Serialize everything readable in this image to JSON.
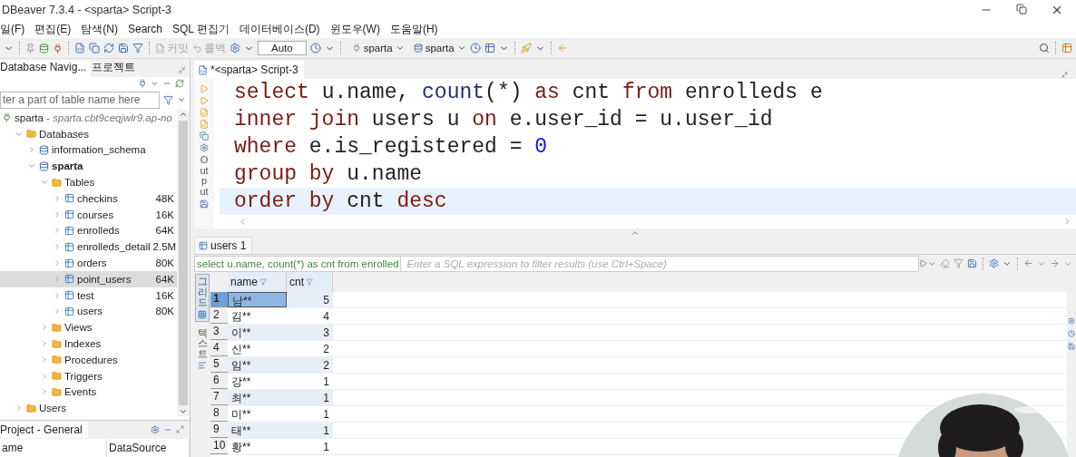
{
  "window": {
    "title": "DBeaver 7.3.4 - <sparta> Script-3"
  },
  "menu": [
    "일(F)",
    "편집(E)",
    "탐색(N)",
    "Search",
    "SQL 편집기",
    "데이터베이스(D)",
    "윈도우(W)",
    "도움말(H)"
  ],
  "toolbar": {
    "commit": {
      "label": "커밋",
      "disabled": true
    },
    "rollback": {
      "label": "롤백",
      "disabled": true
    },
    "mode": "Auto",
    "connection": "sparta",
    "schema": "sparta"
  },
  "navigator": {
    "tabs": [
      {
        "label": "Database Navig...",
        "selected": true
      },
      {
        "label": "프로젝트",
        "selected": false
      }
    ],
    "filter": {
      "placeholder": "ter a part of table name here"
    },
    "tree": [
      {
        "label": "sparta",
        "kind": "connection",
        "detail": "- sparta.cbt9ceqjwlr9.ap-no",
        "selected": false,
        "children": [
          {
            "label": "Databases",
            "kind": "folder",
            "expanded": true,
            "selected": false,
            "children": [
              {
                "label": "information_schema",
                "kind": "database",
                "active": false,
                "expanded": false,
                "selected": false
              },
              {
                "label": "sparta",
                "kind": "database",
                "active": true,
                "expanded": true,
                "selected": false,
                "children": [
                  {
                    "label": "Tables",
                    "kind": "folder",
                    "expanded": true,
                    "selected": false,
                    "children": [
                      {
                        "label": "checkins",
                        "kind": "table",
                        "size": "48K",
                        "expanded": false,
                        "selected": false
                      },
                      {
                        "label": "courses",
                        "kind": "table",
                        "size": "16K",
                        "expanded": false,
                        "selected": false
                      },
                      {
                        "label": "enrolleds",
                        "kind": "table",
                        "size": "64K",
                        "expanded": false,
                        "selected": false
                      },
                      {
                        "label": "enrolleds_detail",
                        "kind": "table",
                        "size": "2.5M",
                        "expanded": false,
                        "selected": false
                      },
                      {
                        "label": "orders",
                        "kind": "table",
                        "size": "80K",
                        "expanded": false,
                        "selected": false
                      },
                      {
                        "label": "point_users",
                        "kind": "table",
                        "size": "64K",
                        "expanded": false,
                        "selected": true
                      },
                      {
                        "label": "test",
                        "kind": "table",
                        "size": "16K",
                        "expanded": false,
                        "selected": false
                      },
                      {
                        "label": "users",
                        "kind": "table",
                        "size": "80K",
                        "expanded": false,
                        "selected": false
                      }
                    ]
                  },
                  {
                    "label": "Views",
                    "kind": "folder",
                    "expanded": false,
                    "selected": false
                  },
                  {
                    "label": "Indexes",
                    "kind": "folder",
                    "expanded": false,
                    "selected": false
                  },
                  {
                    "label": "Procedures",
                    "kind": "folder",
                    "expanded": false,
                    "selected": false
                  },
                  {
                    "label": "Triggers",
                    "kind": "folder",
                    "expanded": false,
                    "selected": false
                  },
                  {
                    "label": "Events",
                    "kind": "folder",
                    "expanded": false,
                    "selected": false
                  }
                ]
              }
            ]
          },
          {
            "label": "Users",
            "kind": "folder",
            "expanded": false,
            "selected": false
          }
        ]
      }
    ]
  },
  "project": {
    "title": "Project - General",
    "columns": [
      "ame",
      "DataSource"
    ]
  },
  "editor": {
    "tab": "*<sparta> Script-3",
    "side_label": "Output",
    "lines": [
      {
        "current": false,
        "tokens": [
          {
            "kind": "keyword",
            "text": "select"
          },
          {
            "kind": "plain",
            "text": " u.name, "
          },
          {
            "kind": "function",
            "text": "count"
          },
          {
            "kind": "plain",
            "text": "(*) "
          },
          {
            "kind": "keyword",
            "text": "as"
          },
          {
            "kind": "plain",
            "text": " cnt "
          },
          {
            "kind": "keyword",
            "text": "from"
          },
          {
            "kind": "plain",
            "text": " enrolleds e"
          }
        ]
      },
      {
        "current": false,
        "tokens": [
          {
            "kind": "keyword",
            "text": "inner join"
          },
          {
            "kind": "plain",
            "text": " users u "
          },
          {
            "kind": "keyword",
            "text": "on"
          },
          {
            "kind": "plain",
            "text": " e.user_id = u.user_id"
          }
        ]
      },
      {
        "current": false,
        "tokens": [
          {
            "kind": "keyword",
            "text": "where"
          },
          {
            "kind": "plain",
            "text": " e.is_registered = "
          },
          {
            "kind": "number",
            "text": "0"
          }
        ]
      },
      {
        "current": false,
        "tokens": [
          {
            "kind": "keyword",
            "text": "group by"
          },
          {
            "kind": "plain",
            "text": " u.name"
          }
        ]
      },
      {
        "current": true,
        "tokens": [
          {
            "kind": "keyword",
            "text": "order by"
          },
          {
            "kind": "plain",
            "text": " cnt "
          },
          {
            "kind": "keyword",
            "text": "desc"
          }
        ]
      }
    ]
  },
  "results": {
    "tab": "users 1",
    "query": "select u.name, count(*) as cnt from enrolled",
    "filter": {
      "placeholder": "Enter a SQL expression to filter results (use Ctrl+Space)"
    },
    "views": [
      {
        "label": "그리드",
        "selected": true
      },
      {
        "label": "텍스트",
        "selected": false
      }
    ],
    "columns": [
      "name",
      "cnt"
    ],
    "rows": [
      {
        "index": "1",
        "name": "남**",
        "cnt": "5",
        "selected": true
      },
      {
        "index": "2",
        "name": "김**",
        "cnt": "4",
        "selected": false
      },
      {
        "index": "3",
        "name": "이**",
        "cnt": "3",
        "selected": false
      },
      {
        "index": "4",
        "name": "신**",
        "cnt": "2",
        "selected": false
      },
      {
        "index": "5",
        "name": "임**",
        "cnt": "2",
        "selected": false
      },
      {
        "index": "6",
        "name": "강**",
        "cnt": "1",
        "selected": false
      },
      {
        "index": "7",
        "name": "최**",
        "cnt": "1",
        "selected": false
      },
      {
        "index": "8",
        "name": "미**",
        "cnt": "1",
        "selected": false
      },
      {
        "index": "9",
        "name": "태**",
        "cnt": "1",
        "selected": false
      },
      {
        "index": "10",
        "name": "황**",
        "cnt": "1",
        "selected": false
      }
    ]
  }
}
